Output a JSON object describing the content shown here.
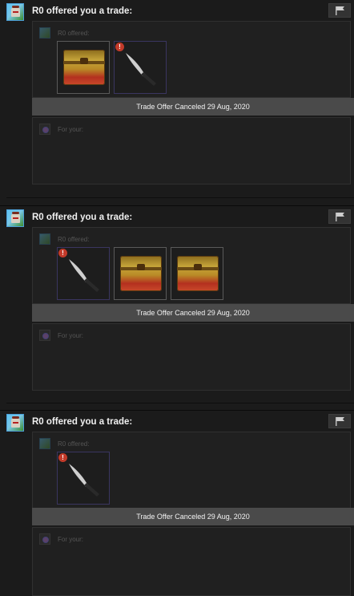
{
  "offers": [
    {
      "headline": "R0 offered you a trade:",
      "offered_label": "R0 offered:",
      "status": "Trade Offer Canceled 29 Aug, 2020",
      "for_label": "For your:",
      "items": [
        {
          "type": "case",
          "icon": "weapon-case-icon"
        },
        {
          "type": "knife",
          "icon": "knife-icon",
          "badge": "!"
        }
      ]
    },
    {
      "headline": "R0 offered you a trade:",
      "offered_label": "R0 offered:",
      "status": "Trade Offer Canceled 29 Aug, 2020",
      "for_label": "For your:",
      "items": [
        {
          "type": "knife",
          "icon": "knife-icon",
          "badge": "!"
        },
        {
          "type": "case",
          "icon": "weapon-case-icon"
        },
        {
          "type": "case",
          "icon": "weapon-case-icon"
        }
      ]
    },
    {
      "headline": "R0 offered you a trade:",
      "offered_label": "R0 offered:",
      "status": "Trade Offer Canceled 29 Aug, 2020",
      "for_label": "For your:",
      "items": [
        {
          "type": "knife",
          "icon": "knife-icon",
          "badge": "!"
        }
      ]
    }
  ],
  "icons": {
    "flag": "flag-icon",
    "avatar": "user-avatar"
  },
  "colors": {
    "background": "#1b1b1b",
    "panel": "#202020",
    "status_bar": "#4a4a4a",
    "warning": "#c23a2a"
  }
}
